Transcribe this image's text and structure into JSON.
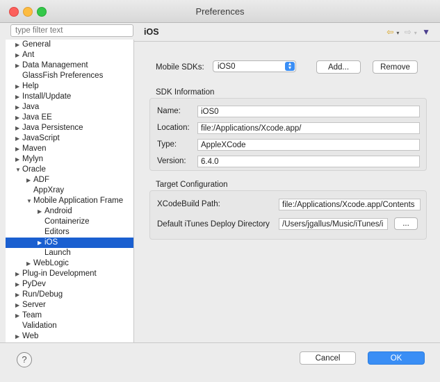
{
  "window": {
    "title": "Preferences"
  },
  "filter": {
    "placeholder": "type filter text"
  },
  "tree": [
    {
      "label": "General",
      "arrow": "collapsed",
      "level": 0
    },
    {
      "label": "Ant",
      "arrow": "collapsed",
      "level": 0
    },
    {
      "label": "Data Management",
      "arrow": "collapsed",
      "level": 0
    },
    {
      "label": "GlassFish Preferences",
      "arrow": "none",
      "level": 0
    },
    {
      "label": "Help",
      "arrow": "collapsed",
      "level": 0
    },
    {
      "label": "Install/Update",
      "arrow": "collapsed",
      "level": 0
    },
    {
      "label": "Java",
      "arrow": "collapsed",
      "level": 0
    },
    {
      "label": "Java EE",
      "arrow": "collapsed",
      "level": 0
    },
    {
      "label": "Java Persistence",
      "arrow": "collapsed",
      "level": 0
    },
    {
      "label": "JavaScript",
      "arrow": "collapsed",
      "level": 0
    },
    {
      "label": "Maven",
      "arrow": "collapsed",
      "level": 0
    },
    {
      "label": "Mylyn",
      "arrow": "collapsed",
      "level": 0
    },
    {
      "label": "Oracle",
      "arrow": "expanded",
      "level": 0
    },
    {
      "label": "ADF",
      "arrow": "collapsed",
      "level": 1
    },
    {
      "label": "AppXray",
      "arrow": "none",
      "level": 1
    },
    {
      "label": "Mobile Application Frame",
      "arrow": "expanded",
      "level": 1
    },
    {
      "label": "Android",
      "arrow": "collapsed",
      "level": 2
    },
    {
      "label": "Containerize",
      "arrow": "none",
      "level": 2
    },
    {
      "label": "Editors",
      "arrow": "none",
      "level": 2
    },
    {
      "label": "iOS",
      "arrow": "collapsed",
      "level": 2,
      "selected": true
    },
    {
      "label": "Launch",
      "arrow": "none",
      "level": 2
    },
    {
      "label": "WebLogic",
      "arrow": "collapsed",
      "level": 1
    },
    {
      "label": "Plug-in Development",
      "arrow": "collapsed",
      "level": 0
    },
    {
      "label": "PyDev",
      "arrow": "collapsed",
      "level": 0
    },
    {
      "label": "Run/Debug",
      "arrow": "collapsed",
      "level": 0
    },
    {
      "label": "Server",
      "arrow": "collapsed",
      "level": 0
    },
    {
      "label": "Team",
      "arrow": "collapsed",
      "level": 0
    },
    {
      "label": "Validation",
      "arrow": "none",
      "level": 0
    },
    {
      "label": "Web",
      "arrow": "collapsed",
      "level": 0
    }
  ],
  "page": {
    "title": "iOS",
    "mobile_sdks_label": "Mobile SDKs:",
    "mobile_sdk_selected": "iOS0",
    "add_button": "Add...",
    "remove_button": "Remove"
  },
  "sdk_info": {
    "title": "SDK Information",
    "name_label": "Name:",
    "name_value": "iOS0",
    "location_label": "Location:",
    "location_value": "file:/Applications/Xcode.app/",
    "type_label": "Type:",
    "type_value": "AppleXCode",
    "version_label": "Version:",
    "version_value": "6.4.0"
  },
  "target_config": {
    "title": "Target Configuration",
    "xcode_label": "XCodeBuild Path:",
    "xcode_value": "file:/Applications/Xcode.app/Contents",
    "itunes_label": "Default iTunes Deploy Directory",
    "itunes_value": "/Users/jgallus/Music/iTunes/i",
    "browse_button": "..."
  },
  "footer": {
    "help": "?",
    "cancel": "Cancel",
    "ok": "OK"
  },
  "colors": {
    "selection": "#1a5fd0",
    "primary_button": "#3a8ef5"
  }
}
